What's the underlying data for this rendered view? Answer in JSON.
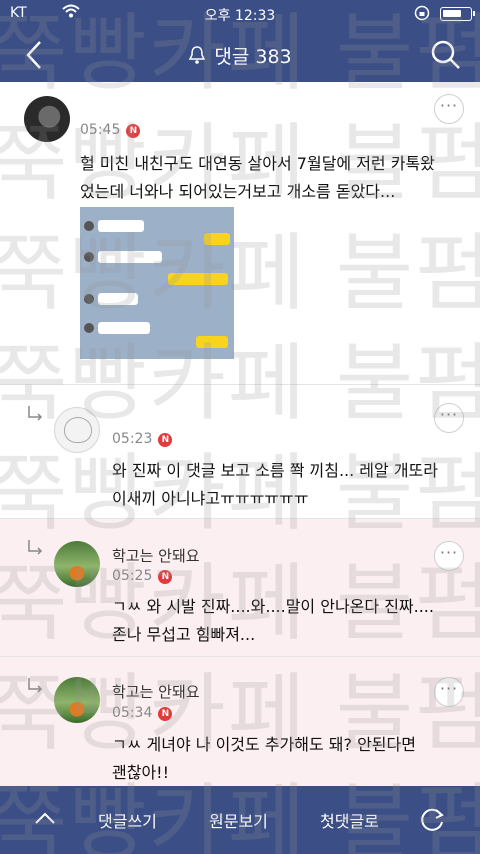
{
  "status_bar": {
    "carrier": "KT",
    "time": "오후 12:33"
  },
  "header": {
    "title": "댓글 383"
  },
  "comments": [
    {
      "nickname": "",
      "time": "05:45",
      "badge": "N",
      "text_lines": [
        "헐 미친 내친구도 대연동 살아서 7월달에 저런 카톡왔",
        "었는데 너와나 되어있는거보고 개소름 돋았다..."
      ]
    },
    {
      "nickname": "",
      "time": "05:23",
      "badge": "N",
      "text_lines": [
        "와 진짜 이 댓글 보고 소름 쫙 끼침... 레알 개또라",
        "이새끼 아니냐고ㅠㅠㅠㅠㅠㅠ"
      ]
    },
    {
      "nickname": "학고는 안돼요",
      "time": "05:25",
      "badge": "N",
      "text_lines": [
        "ㄱㅆ 와 시발 진짜....와....말이 안나온다 진짜....",
        "존나 무섭고 힘빠져..."
      ]
    },
    {
      "nickname": "학고는 안돼요",
      "time": "05:34",
      "badge": "N",
      "text_lines": [
        "ㄱㅆ 게녀야 나 이것도 추가해도 돼? 안된다면",
        "괜찮아!!"
      ]
    }
  ],
  "watermark": "쭉빵카페 불펌 금지",
  "bottom_bar": {
    "write": "댓글쓰기",
    "original": "원문보기",
    "first": "첫댓글로"
  },
  "colors": {
    "bar": "#3b4f86",
    "pink_row": "#fbeff1",
    "badge": "#e23b3b"
  }
}
